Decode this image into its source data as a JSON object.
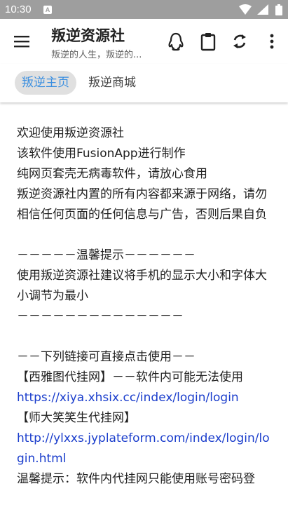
{
  "status_bar": {
    "time": "10:30",
    "notification_badge": "A",
    "icons": [
      "wifi-icon",
      "signal-icon",
      "battery-icon"
    ]
  },
  "app_bar": {
    "title": "叛逆资源社",
    "subtitle": "叛逆的人生，叛逆的...",
    "actions": [
      "qq-icon",
      "clipboard-icon",
      "refresh-icon",
      "more-vert-icon"
    ]
  },
  "tabs": [
    {
      "label": "叛逆主页",
      "active": true
    },
    {
      "label": "叛逆商城",
      "active": false
    }
  ],
  "content": {
    "intro_1": "欢迎使用叛逆资源社",
    "intro_2": "该软件使用FusionApp进行制作",
    "intro_3": "纯网页套壳无病毒软件，请放心食用",
    "intro_4": "叛逆资源社内置的所有内容都来源于网络，请勿相信任何页面的任何信息与广告，否则后果自负",
    "tip_header": "－－－－－温馨提示－－－－－－",
    "tip_text": "使用叛逆资源社建议将手机的显示大小和字体大小调节为最小",
    "divider": "－－－－－－－－－－－－－－",
    "links_header": "－－下列链接可直接点击使用－－",
    "link1_label": "【西雅图代挂网】－－软件内可能无法使用",
    "link1_url": "https://xiya.xhsix.cc/index/login/login",
    "link2_label": "【师大笑笑生代挂网】",
    "link2_url": "http://ylxxs.jyplateform.com/index/login/login.html",
    "final_tip": "温馨提示：软件内代挂网只能使用账号密码登"
  },
  "colors": {
    "status_bar": "#9e9e9e",
    "tab_active_text": "#3b8fe0",
    "tab_active_bg": "#e0e0e0",
    "link": "#1a3dcc"
  }
}
